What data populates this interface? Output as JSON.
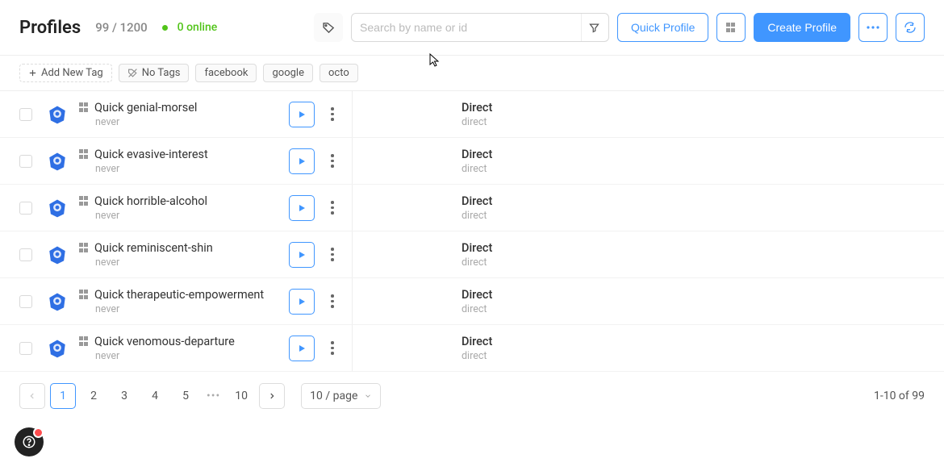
{
  "header": {
    "title": "Profiles",
    "count": "99 / 1200",
    "online": "0 online",
    "search_placeholder": "Search by name or id",
    "quick_profile": "Quick Profile",
    "create_profile": "Create Profile"
  },
  "tags": {
    "add_new": "Add New Tag",
    "no_tags": "No Tags",
    "items": [
      "facebook",
      "google",
      "octo"
    ]
  },
  "rows": [
    {
      "name": "Quick genial-morsel",
      "sub": "never",
      "conn": "Direct",
      "conn_sub": "direct"
    },
    {
      "name": "Quick evasive-interest",
      "sub": "never",
      "conn": "Direct",
      "conn_sub": "direct"
    },
    {
      "name": "Quick horrible-alcohol",
      "sub": "never",
      "conn": "Direct",
      "conn_sub": "direct"
    },
    {
      "name": "Quick reminiscent-shin",
      "sub": "never",
      "conn": "Direct",
      "conn_sub": "direct"
    },
    {
      "name": "Quick therapeutic-empowerment",
      "sub": "never",
      "conn": "Direct",
      "conn_sub": "direct"
    },
    {
      "name": "Quick venomous-departure",
      "sub": "never",
      "conn": "Direct",
      "conn_sub": "direct"
    }
  ],
  "pagination": {
    "pages": [
      "1",
      "2",
      "3",
      "4",
      "5"
    ],
    "last": "10",
    "per_page": "10 / page",
    "info": "1-10 of 99"
  }
}
